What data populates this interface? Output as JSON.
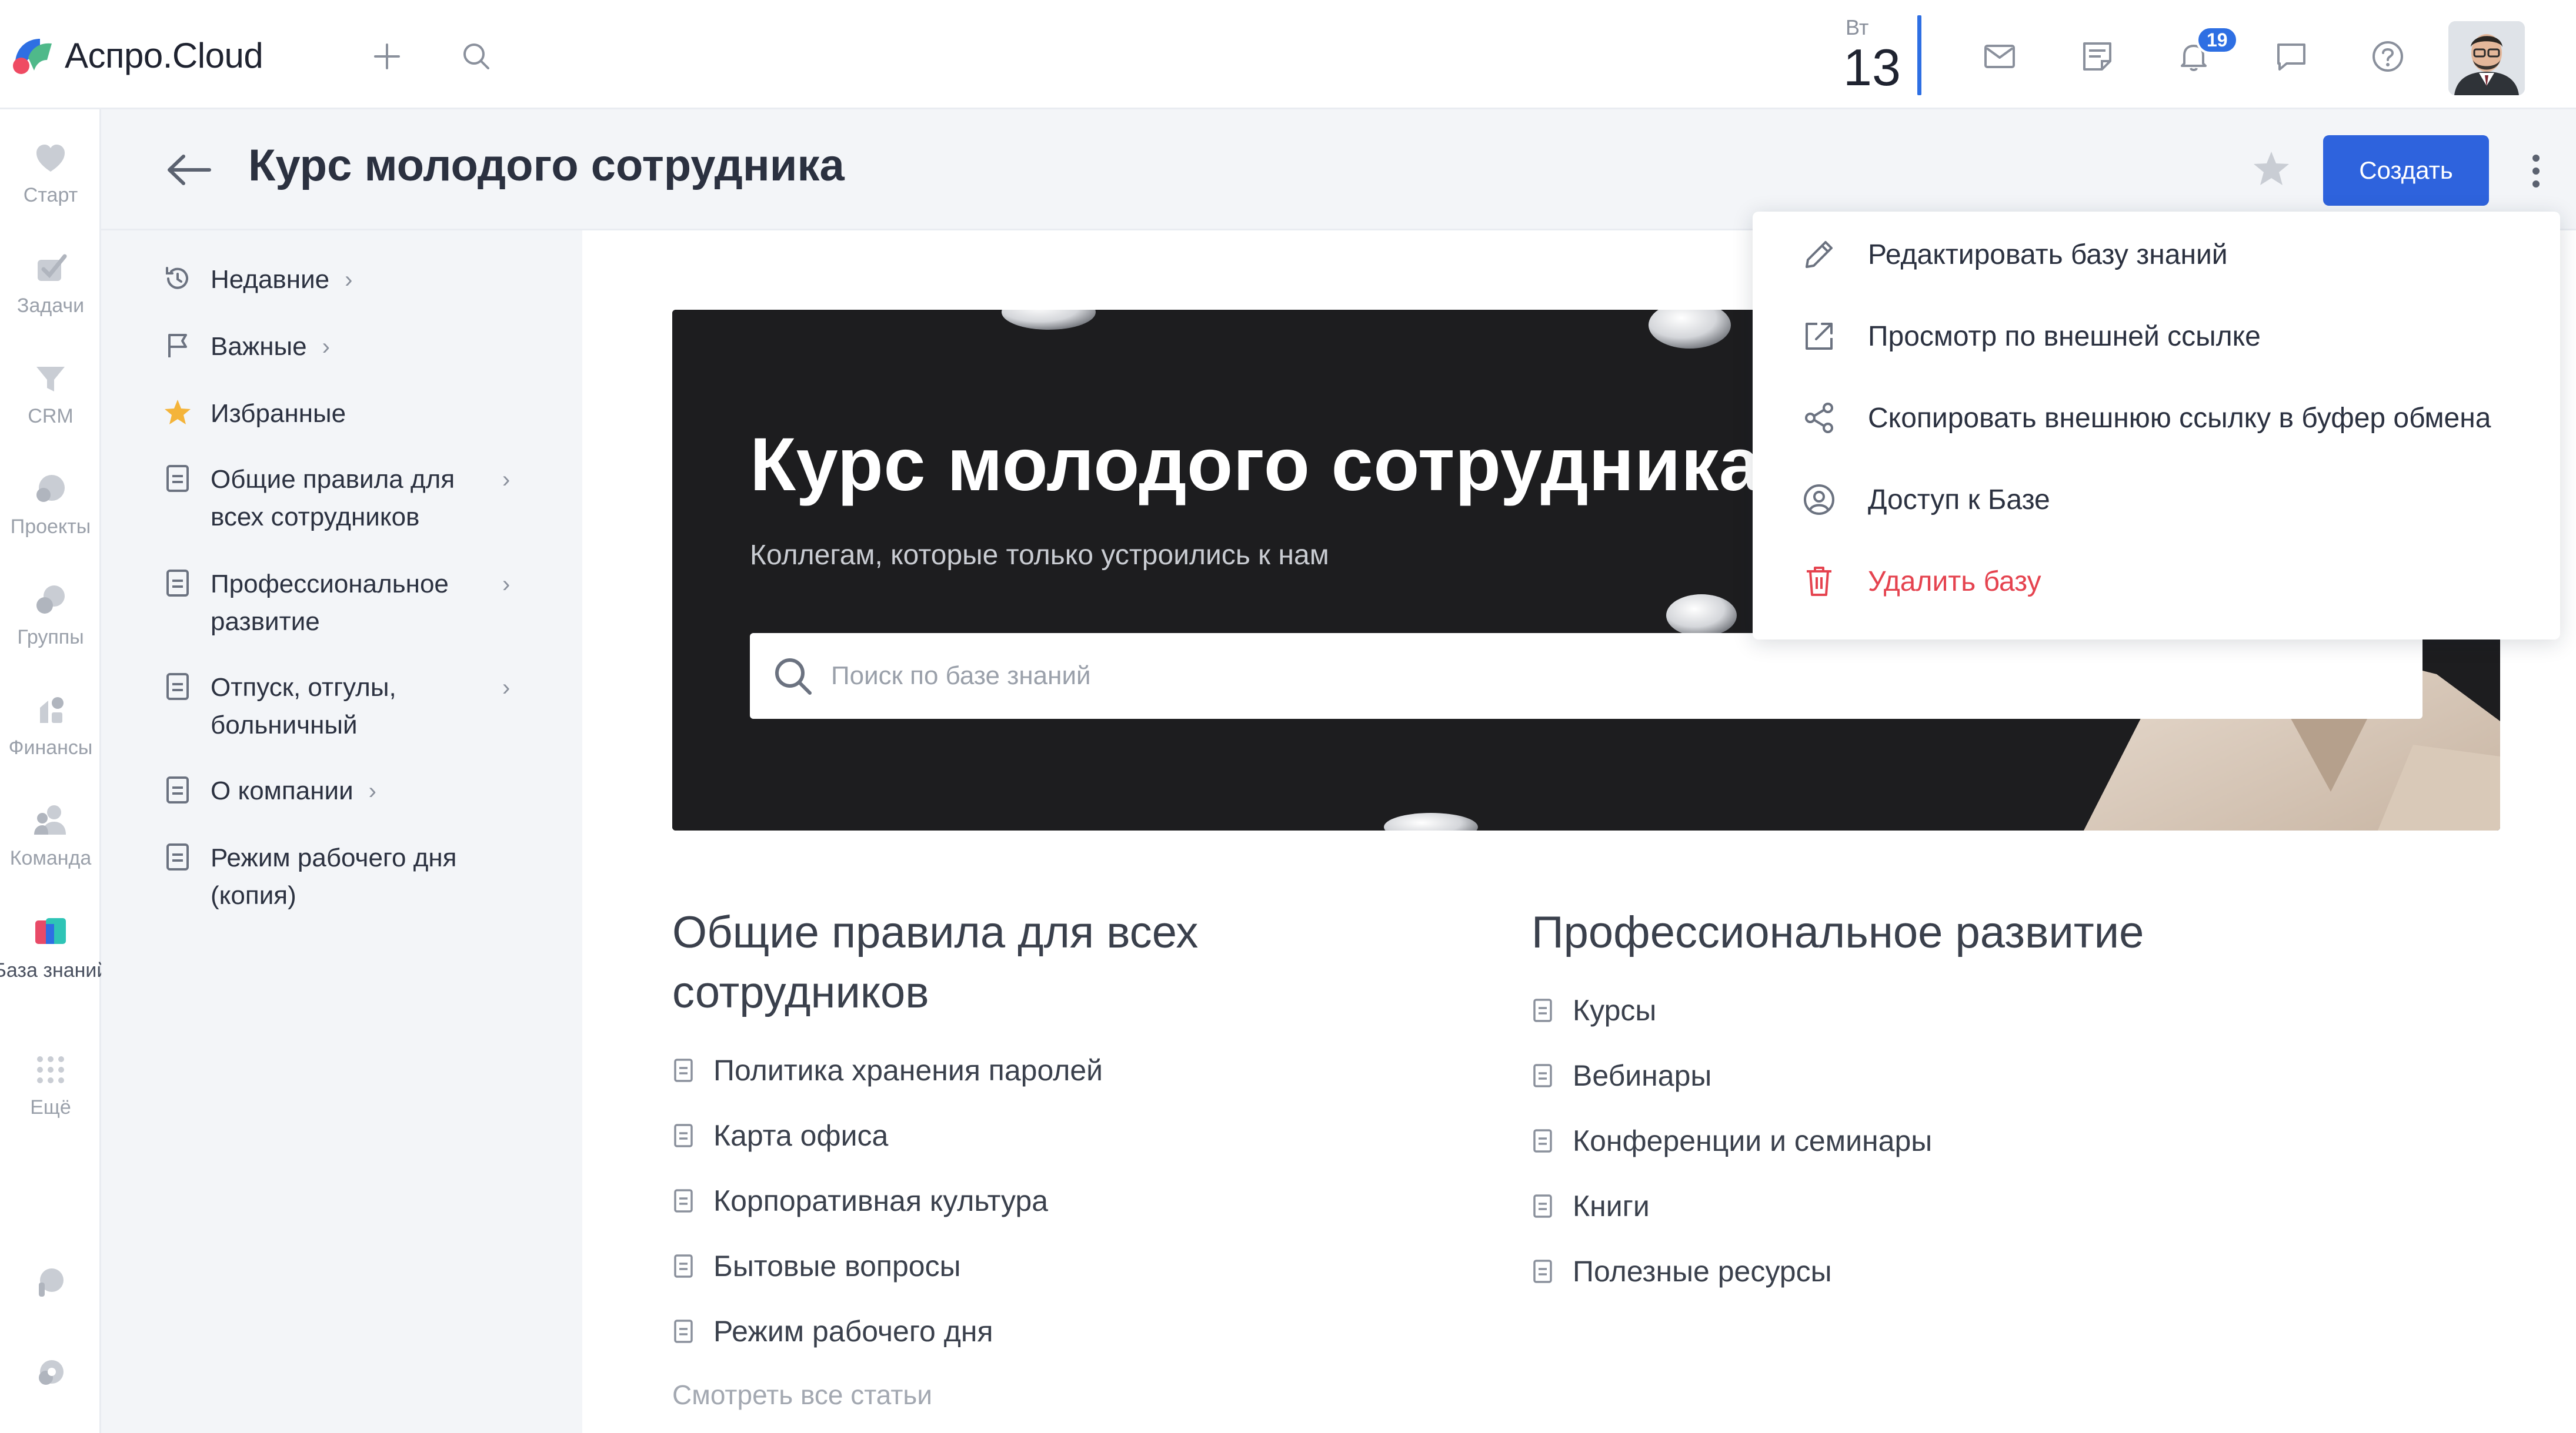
{
  "app": {
    "name": "Аспро.Cloud"
  },
  "topbar": {
    "date": {
      "weekday": "Вт",
      "day": "13"
    },
    "notifications_count": "19",
    "icons": [
      "plus-icon",
      "search-icon",
      "mail-icon",
      "notes-icon",
      "bell-icon",
      "chat-icon",
      "help-icon"
    ]
  },
  "rail": {
    "items": [
      {
        "label": "Старт",
        "icon": "home-icon"
      },
      {
        "label": "Задачи",
        "icon": "tasks-icon"
      },
      {
        "label": "CRM",
        "icon": "crm-icon"
      },
      {
        "label": "Проекты",
        "icon": "projects-icon"
      },
      {
        "label": "Группы",
        "icon": "groups-icon"
      },
      {
        "label": "Финансы",
        "icon": "finance-icon"
      },
      {
        "label": "Команда",
        "icon": "team-icon"
      },
      {
        "label": "База знаний",
        "icon": "knowledge-base-icon",
        "active": true
      },
      {
        "label": "Ещё",
        "icon": "more-grid-icon"
      }
    ]
  },
  "header": {
    "title": "Курс молодого сотрудника",
    "create_label": "Создать"
  },
  "nav": {
    "items": [
      {
        "label": "Недавние",
        "icon": "history-icon",
        "chevron": "›"
      },
      {
        "label": "Важные",
        "icon": "flag-icon",
        "chevron": "›"
      },
      {
        "label": "Избранные",
        "icon": "star-icon",
        "chevron": ""
      },
      {
        "label": "Общие правила для всех сотрудников",
        "icon": "document-icon",
        "chevron": "›"
      },
      {
        "label": "Профессиональное развитие",
        "icon": "document-icon",
        "chevron": "›"
      },
      {
        "label": "Отпуск, отгулы, больничный",
        "icon": "document-icon",
        "chevron": "›"
      },
      {
        "label": "О компании",
        "icon": "document-icon",
        "chevron": "›"
      },
      {
        "label": "Режим рабочего дня (копия)",
        "icon": "document-icon",
        "chevron": ""
      }
    ]
  },
  "hero": {
    "title": "Курс молодого сотрудника",
    "subtitle": "Коллегам, которые только устроились к нам",
    "search_placeholder": "Поиск по базе знаний"
  },
  "sections": [
    {
      "title": "Общие правила для всех сотрудников",
      "articles": [
        "Политика хранения паролей",
        "Карта офиса",
        "Корпоративная культура",
        "Бытовые вопросы",
        "Режим рабочего дня"
      ],
      "see_all": "Смотреть все статьи"
    },
    {
      "title": "Профессиональное развитие",
      "articles": [
        "Курсы",
        "Вебинары",
        "Конференции и семинары",
        "Книги",
        "Полезные ресурсы"
      ]
    }
  ],
  "menu": {
    "items": [
      {
        "label": "Редактировать базу знаний",
        "icon": "pencil-icon"
      },
      {
        "label": "Просмотр по внешней ссылке",
        "icon": "external-link-icon"
      },
      {
        "label": "Скопировать внешнюю ссылку в буфер обмена",
        "icon": "share-icon"
      },
      {
        "label": "Доступ к Базе",
        "icon": "user-circle-icon"
      },
      {
        "label": "Удалить базу",
        "icon": "trash-icon",
        "danger": true
      }
    ]
  },
  "colors": {
    "accent": "#2e63dd",
    "danger": "#e5434f",
    "badge": "#2e6fe3"
  }
}
